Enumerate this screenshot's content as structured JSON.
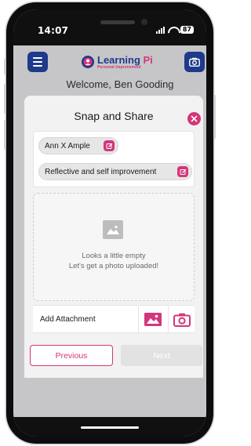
{
  "status_bar": {
    "time": "14:07",
    "battery": "87"
  },
  "header": {
    "menu_icon": "hamburger-menu-icon",
    "camera_icon": "camera-icon",
    "logo_title_main": "Learning ",
    "logo_title_accent": "Pi",
    "logo_subtitle": "Personal Improvement"
  },
  "welcome_text": "Welcome, Ben Gooding",
  "card": {
    "title": "Snap and Share",
    "close_icon": "close-icon",
    "tags": [
      {
        "label": "Ann X Ample",
        "edit_icon": "edit-icon"
      },
      {
        "label": "Reflective and self improvement",
        "edit_icon": "edit-icon"
      }
    ],
    "empty_state": {
      "line1": "Looks a little empty",
      "line2": "Let's get a photo uploaded!",
      "icon": "image-placeholder-icon"
    },
    "attachment": {
      "label": "Add Attachment",
      "gallery_icon": "gallery-icon",
      "camera_icon": "camera-icon"
    },
    "buttons": {
      "previous": "Previous",
      "next": "Next"
    }
  },
  "colors": {
    "primary": "#1e3a8a",
    "accent": "#d4357b",
    "background": "#c6c6c8"
  }
}
